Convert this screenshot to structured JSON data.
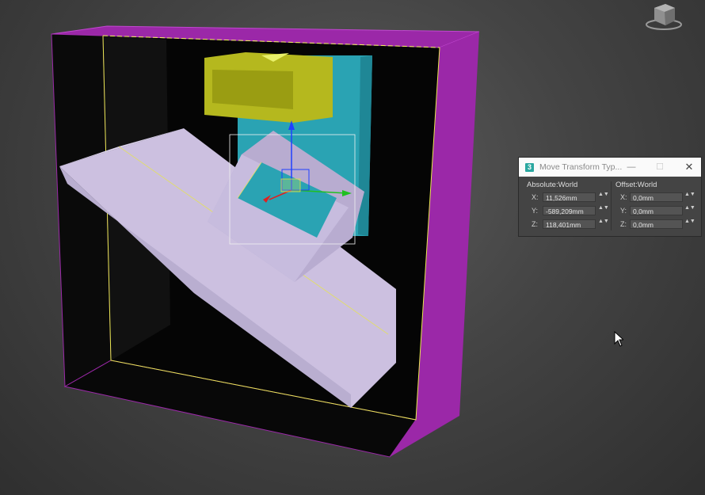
{
  "viewport": {
    "colors": {
      "frame": "#9b28a8",
      "yellow_box": "#b5b81e",
      "teal_box": "#2aa3b3",
      "ramp": "#ccc0e0",
      "selection_edge": "#f2f25a"
    },
    "viewcube_icon": "viewcube-icon"
  },
  "dialog": {
    "title": "Move Transform Typ...",
    "app_icon_text": "3",
    "absolute_label": "Absolute:World",
    "offset_label": "Offset:World",
    "absolute": [
      {
        "axis": "X:",
        "value": "11,526mm"
      },
      {
        "axis": "Y:",
        "value": "-589,209mm"
      },
      {
        "axis": "Z:",
        "value": "118,401mm"
      }
    ],
    "offset": [
      {
        "axis": "X:",
        "value": "0,0mm"
      },
      {
        "axis": "Y:",
        "value": "0,0mm"
      },
      {
        "axis": "Z:",
        "value": "0,0mm"
      }
    ],
    "buttons": {
      "minimize": "—",
      "maximize": "☐",
      "close": "✕"
    },
    "spinner_glyph": "▲▼"
  }
}
